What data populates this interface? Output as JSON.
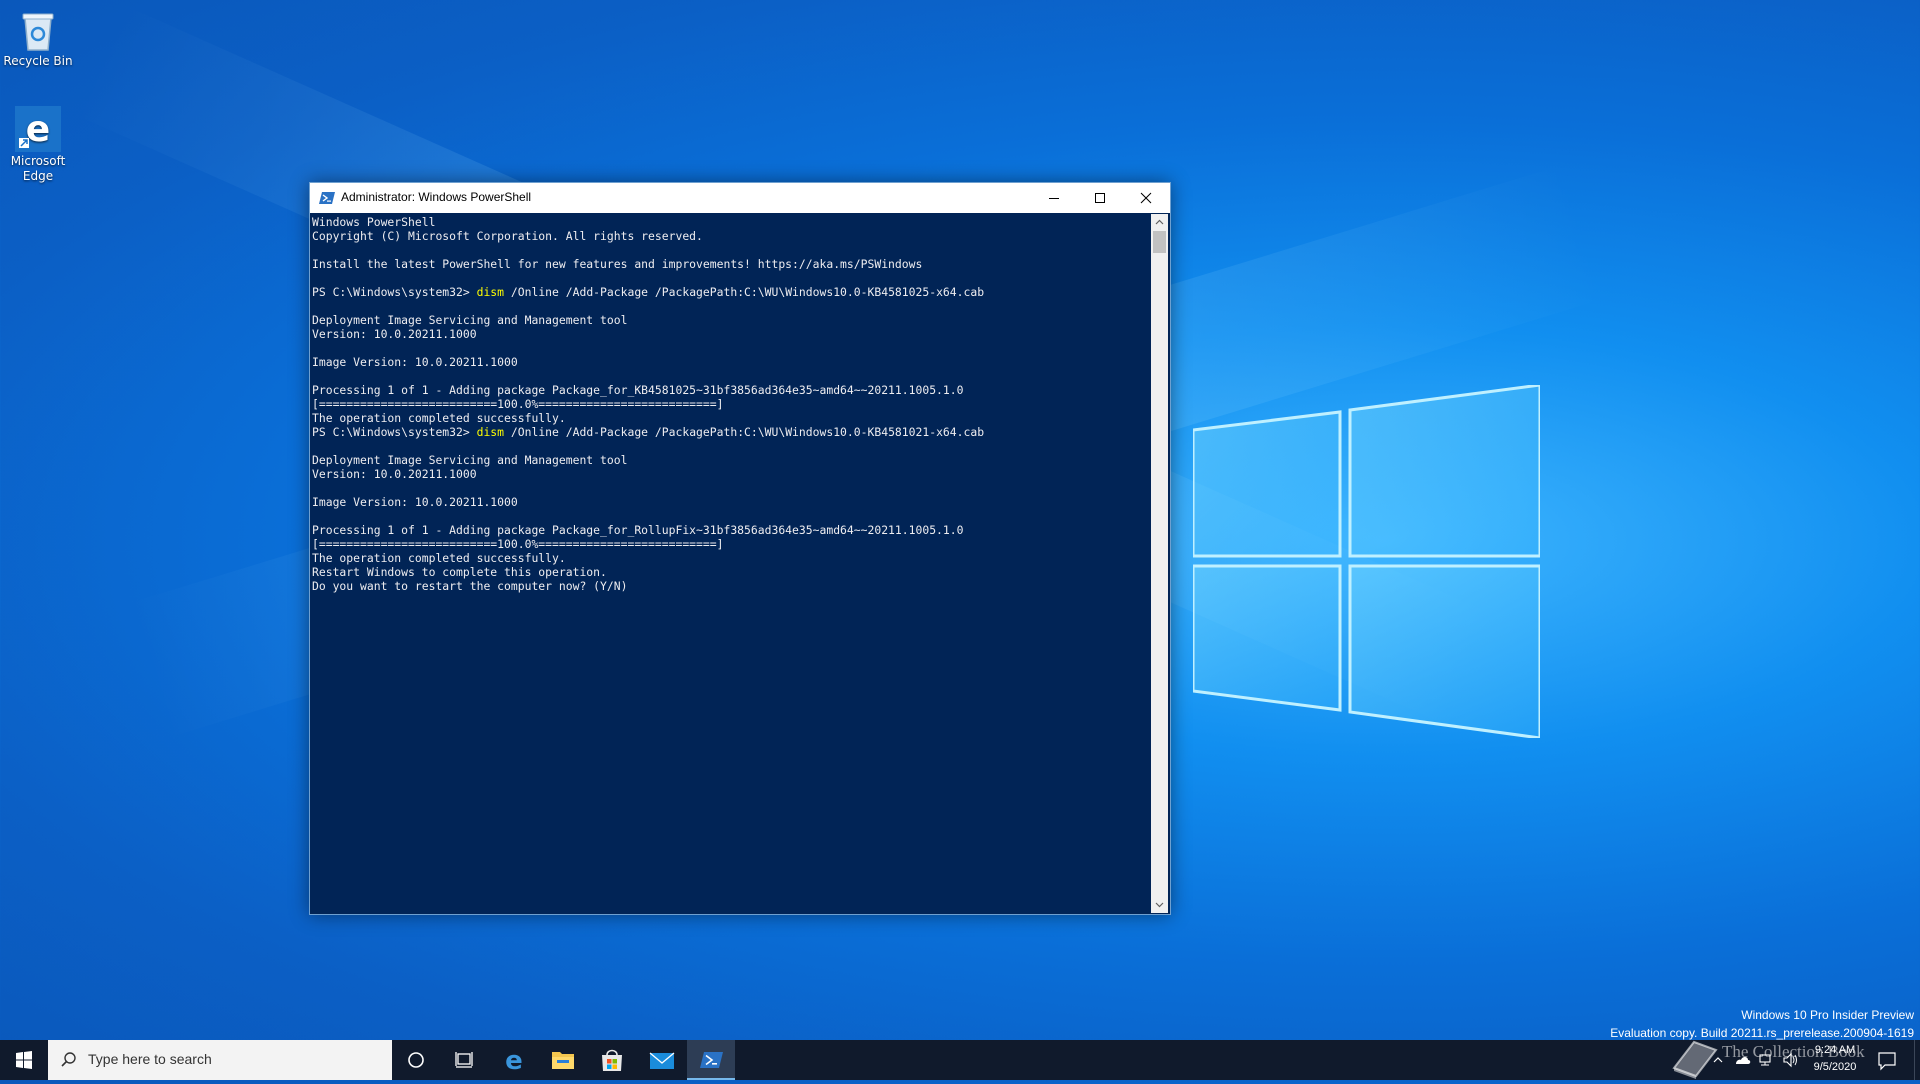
{
  "desktop": {
    "icons": [
      {
        "label": "Recycle Bin",
        "icon": "recycle-bin-icon"
      },
      {
        "label": "Microsoft Edge",
        "icon": "edge-icon"
      }
    ],
    "watermark": {
      "line1": "Windows 10 Pro Insider Preview",
      "line2": "Evaluation copy. Build 20211.rs_prerelease.200904-1619"
    }
  },
  "window": {
    "title": "Administrator: Windows PowerShell",
    "controls": {
      "minimize": "minimize-icon",
      "maximize": "maximize-icon",
      "close": "close-icon"
    }
  },
  "console": {
    "lines": [
      "Windows PowerShell",
      "Copyright (C) Microsoft Corporation. All rights reserved.",
      "",
      "Install the latest PowerShell for new features and improvements! https://aka.ms/PSWindows",
      "",
      "PS C:\\Windows\\system32> |dism| /Online /Add-Package /PackagePath:C:\\WU\\Windows10.0-KB4581025-x64.cab",
      "",
      "Deployment Image Servicing and Management tool",
      "Version: 10.0.20211.1000",
      "",
      "Image Version: 10.0.20211.1000",
      "",
      "Processing 1 of 1 - Adding package Package_for_KB4581025~31bf3856ad364e35~amd64~~20211.1005.1.0",
      "[==========================100.0%==========================]",
      "The operation completed successfully.",
      "PS C:\\Windows\\system32> |dism| /Online /Add-Package /PackagePath:C:\\WU\\Windows10.0-KB4581021-x64.cab",
      "",
      "Deployment Image Servicing and Management tool",
      "Version: 10.0.20211.1000",
      "",
      "Image Version: 10.0.20211.1000",
      "",
      "Processing 1 of 1 - Adding package Package_for_RollupFix~31bf3856ad364e35~amd64~~20211.1005.1.0",
      "[==========================100.0%==========================]",
      "The operation completed successfully.",
      "Restart Windows to complete this operation.",
      "Do you want to restart the computer now? (Y/N)"
    ],
    "colors": {
      "background": "#012456",
      "text": "#eeedf0",
      "keyword": "#ffff00"
    }
  },
  "taskbar": {
    "search_placeholder": "Type here to search",
    "apps": [
      {
        "name": "cortana",
        "icon": "cortana-icon"
      },
      {
        "name": "task-view",
        "icon": "task-view-icon"
      },
      {
        "name": "edge",
        "icon": "edge-icon"
      },
      {
        "name": "file-explorer",
        "icon": "folder-icon"
      },
      {
        "name": "store",
        "icon": "store-icon"
      },
      {
        "name": "mail",
        "icon": "mail-icon"
      },
      {
        "name": "powershell",
        "icon": "powershell-icon",
        "active": true
      }
    ],
    "clock": {
      "time": "9:24 AM",
      "date": "9/5/2020"
    },
    "overlay_text": "The Collection Book"
  }
}
